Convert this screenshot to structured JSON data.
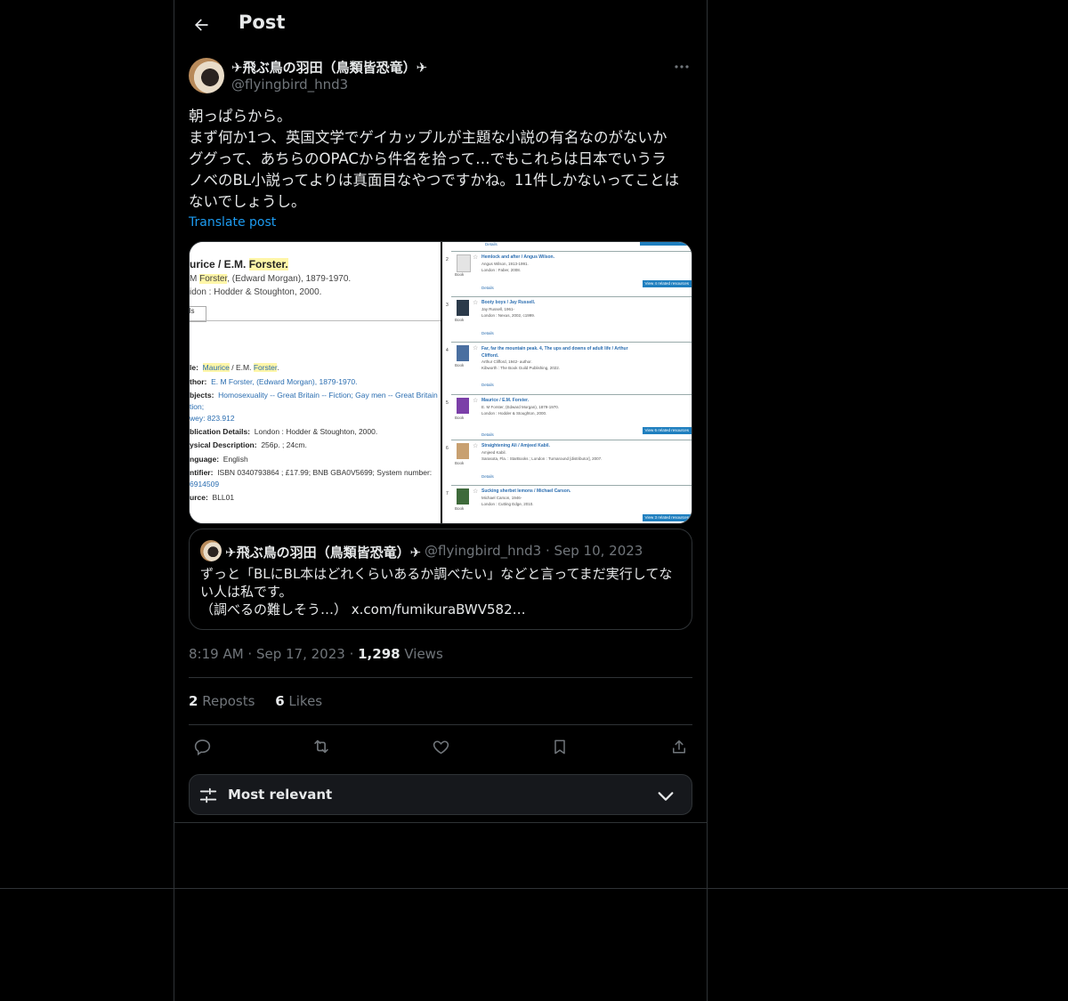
{
  "header": {
    "title": "Post"
  },
  "post": {
    "author": {
      "display_name": "✈飛ぶ鳥の羽田（鳥類皆恐竜）✈",
      "handle": "@flyingbird_hnd3"
    },
    "text_lines": [
      "朝っぱらから。",
      "まず何か1つ、英国文学でゲイカップルが主題な小説の有名なのがないか",
      "ググって、あちらのOPACから件名を拾って…でもこれらは日本でいうラ",
      "ノベのBL小説ってよりは真面目なやつですかね。11件しかないってことは",
      "ないでしょうし。"
    ],
    "translate_label": "Translate post",
    "timestamp": "8:19 AM · Sep 17, 2023",
    "views_count": "1,298",
    "views_label": "Views",
    "reposts_count": "2",
    "reposts_label": "Reposts",
    "likes_count": "6",
    "likes_label": "Likes"
  },
  "media": {
    "left": {
      "title_pre": "urice / E.M. ",
      "title_hl": "Forster.",
      "line1_pre": "M ",
      "line1_hl": "Forster",
      "line1_post": ", (Edward Morgan), 1879-1970.",
      "line2": "idon : Hodder & Stoughton, 2000.",
      "tab": "ils",
      "fields": [
        {
          "label": "le:",
          "value_hl1": "Maurice",
          "value_mid": " / E.M. ",
          "value_hl2": "Forster",
          "value_post": "."
        },
        {
          "label": "thor:",
          "value": "E. M Forster, (Edward Morgan), 1879-1970."
        },
        {
          "label": "bjects:",
          "value": "Homosexuality -- Great Britain -- Fiction; Gay men -- Great Britain"
        },
        {
          "label": "",
          "value": "tion;"
        },
        {
          "label": "wey:",
          "value": "823.912"
        },
        {
          "label": "blication Details:",
          "value": "London : Hodder & Stoughton, 2000."
        },
        {
          "label": "ysical Description:",
          "value": "256p. ; 24cm."
        },
        {
          "label": "nguage:",
          "value": "English"
        },
        {
          "label": "ntifier:",
          "value": "ISBN 0340793864 ; £17.99; BNB GBA0V5699; System number:"
        },
        {
          "label": "",
          "value": "6914509"
        },
        {
          "label": "urce:",
          "value": "BLL01"
        }
      ]
    },
    "right": {
      "top_details": "Details",
      "items": [
        {
          "num": "2",
          "title": "Hemlock and after / Angus Wilson.",
          "l1": "Angus Wilson, 1913-1991.",
          "l2": "London : Faber, 2008.",
          "details": "Details",
          "badge": "View 4 related resources",
          "thumb": "#d9d9d9",
          "type": "Book"
        },
        {
          "num": "3",
          "title": "Booty boys / Jay Russell.",
          "l1": "Jay Russell, 1961-",
          "l2": "London : Nexus, 2002, c1999.",
          "details": "Details",
          "badge": "",
          "thumb": "#2b3a4a",
          "type": "Book"
        },
        {
          "num": "4",
          "title": "Far, far the mountain peak. 4, The ups and downs of adult life / Arthur Clifford.",
          "l1": "Arthur Clifford, 1942- author.",
          "l2": "Kibworth : The Book Guild Publishing, 2022.",
          "details": "Details",
          "badge": "",
          "thumb": "#4a6fa0",
          "type": "Book"
        },
        {
          "num": "5",
          "title": "Maurice / E.M. Forster.",
          "l1": "E. M Forster, (Edward Morgan), 1879-1970.",
          "l2": "London : Hodder & Stoughton, 2000.",
          "details": "Details",
          "badge": "View 6 related resources",
          "thumb": "#7b3fa8",
          "type": "Book"
        },
        {
          "num": "6",
          "title": "Straightening Ali / Amjeed Kabil.",
          "l1": "Amjeed Kabil.",
          "l2": "Sarasota, Fla. : StarBooks ; London : Turnaround [distributor], 2007.",
          "details": "Details",
          "badge": "",
          "thumb": "#c8a070",
          "type": "Book"
        },
        {
          "num": "7",
          "title": "Sucking sherbet lemons / Michael Carson.",
          "l1": "Michael Carson, 1946-",
          "l2": "London : Cutting Edge, 2010.",
          "details": "",
          "badge": "View 3 related resources",
          "thumb": "#3e6a3a",
          "type": "Book"
        }
      ]
    }
  },
  "quote": {
    "display_name": "✈飛ぶ鳥の羽田（鳥類皆恐竜）✈",
    "meta": "@flyingbird_hnd3 · Sep 10, 2023",
    "text_lines": [
      "ずっと「BLにBL本はどれくらいあるか調べたい」などと言ってまだ実行してな",
      "い人は私です。",
      "（調べるの難しそう…） x.com/fumikuraBWV582…"
    ]
  },
  "sort": {
    "label": "Most relevant"
  },
  "icons": [
    "back-arrow-icon",
    "more-icon",
    "reply-icon",
    "repost-icon",
    "like-icon",
    "bookmark-icon",
    "share-icon",
    "sliders-icon",
    "chevron-down-icon"
  ]
}
